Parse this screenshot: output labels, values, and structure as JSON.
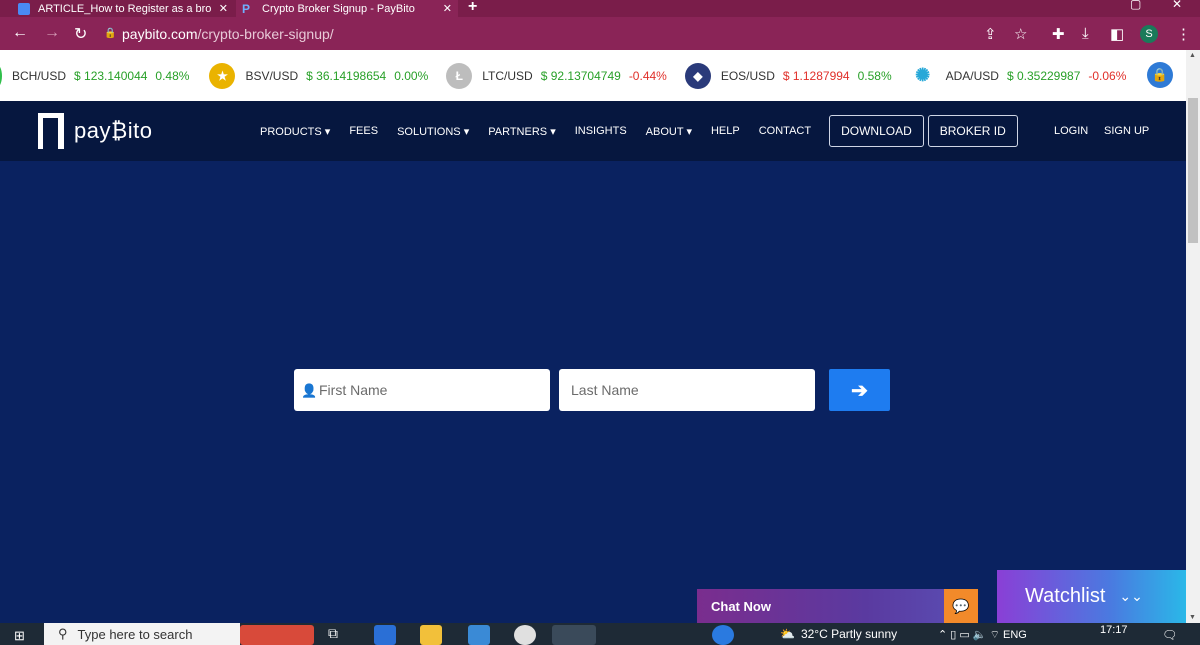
{
  "browser": {
    "tabs": [
      {
        "title": "ARTICLE_How to Register as a bro",
        "close": "✕"
      },
      {
        "title": "Crypto Broker Signup - PayBito",
        "close": "✕"
      }
    ],
    "new_tab": "+",
    "url_domain": "paybito.com",
    "url_path": "/crypto-broker-signup/",
    "profile_initial": "S"
  },
  "ticker": [
    {
      "pair": "BCH/USD",
      "price": "$ 123.140044",
      "change": "0.48%",
      "trend": "up",
      "coin_color": "#2fbf4a",
      "icon": "bch-coin-icon"
    },
    {
      "pair": "BSV/USD",
      "price": "$ 36.14198654",
      "change": "0.00%",
      "trend": "flat",
      "coin_color": "#eab300",
      "icon": "bsv-coin-icon"
    },
    {
      "pair": "LTC/USD",
      "price": "$ 92.13704749",
      "change": "-0.44%",
      "trend": "down",
      "coin_color": "#bdbdbd",
      "icon": "ltc-coin-icon"
    },
    {
      "pair": "EOS/USD",
      "price": "$ 1.1287994",
      "change": "0.58%",
      "trend": "up",
      "coin_color": "#2a3a7a",
      "icon": "eos-coin-icon"
    },
    {
      "pair": "ADA/USD",
      "price": "$ 0.35229987",
      "change": "-0.06%",
      "trend": "down",
      "coin_color": "#26a8d8",
      "icon": "ada-coin-icon"
    }
  ],
  "site": {
    "logo_text": "pay₿ito",
    "menu": [
      {
        "label": "PRODUCTS",
        "caret": "▾"
      },
      {
        "label": "FEES",
        "caret": ""
      },
      {
        "label": "SOLUTIONS",
        "caret": "▾"
      },
      {
        "label": "PARTNERS",
        "caret": "▾"
      },
      {
        "label": "INSIGHTS",
        "caret": ""
      },
      {
        "label": "ABOUT",
        "caret": "▾"
      },
      {
        "label": "HELP",
        "caret": ""
      },
      {
        "label": "CONTACT",
        "caret": ""
      }
    ],
    "download_label": "DOWNLOAD",
    "broker_id_label": "BROKER ID",
    "login_label": "LOGIN",
    "signup_label": "SIGN UP"
  },
  "form": {
    "first_name_placeholder": "First Name",
    "last_name_placeholder": "Last Name",
    "submit_glyph": "➔"
  },
  "widgets": {
    "chat_label": "Chat Now",
    "watchlist_label": "Watchlist"
  },
  "taskbar": {
    "search_placeholder": "Type here to search",
    "weather": "32°C  Partly sunny",
    "language": "ENG",
    "time": "17:17"
  },
  "colors": {
    "hero_bg": "#0a2260",
    "nav_bg": "#06173f",
    "accent": "#1e7cf0",
    "browser_frame": "#8a2457"
  }
}
